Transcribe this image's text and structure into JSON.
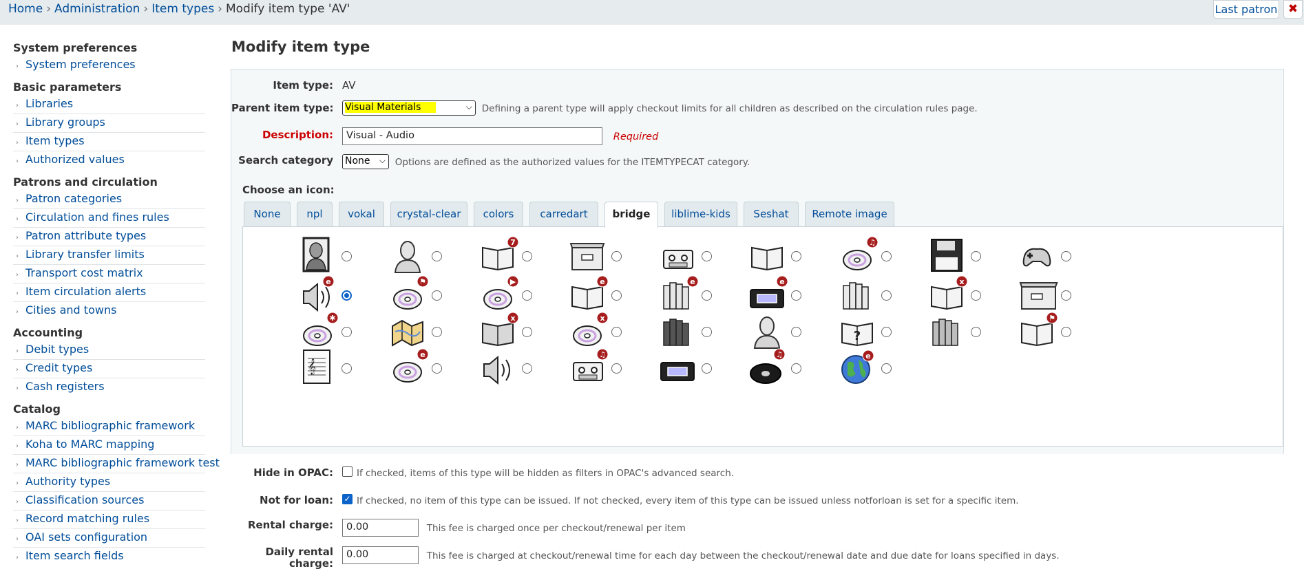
{
  "breadcrumb": {
    "home": "Home",
    "administration": "Administration",
    "item_types": "Item types",
    "current": "Modify item type 'AV'",
    "separator": "›"
  },
  "header": {
    "last_patron": "Last patron",
    "close_glyph": "✖"
  },
  "sidebar": {
    "sections": [
      {
        "title": "System preferences",
        "items": [
          "System preferences"
        ]
      },
      {
        "title": "Basic parameters",
        "items": [
          "Libraries",
          "Library groups",
          "Item types",
          "Authorized values"
        ]
      },
      {
        "title": "Patrons and circulation",
        "items": [
          "Patron categories",
          "Circulation and fines rules",
          "Patron attribute types",
          "Library transfer limits",
          "Transport cost matrix",
          "Item circulation alerts",
          "Cities and towns"
        ]
      },
      {
        "title": "Accounting",
        "items": [
          "Debit types",
          "Credit types",
          "Cash registers"
        ]
      },
      {
        "title": "Catalog",
        "items": [
          "MARC bibliographic framework",
          "Koha to MARC mapping",
          "MARC bibliographic framework test",
          "Authority types",
          "Classification sources",
          "Record matching rules",
          "OAI sets configuration",
          "Item search fields"
        ]
      }
    ]
  },
  "page": {
    "title": "Modify item type"
  },
  "form": {
    "item_type": {
      "label": "Item type:",
      "value": "AV"
    },
    "parent_type": {
      "label": "Parent item type:",
      "value": "Visual Materials",
      "hint": "Defining a parent type will apply checkout limits for all children as described on the circulation rules page."
    },
    "description": {
      "label": "Description:",
      "value": "Visual - Audio",
      "required": "Required"
    },
    "search_category": {
      "label": "Search category",
      "value": "None",
      "hint": "Options are defined as the authorized values for the ITEMTYPECAT category."
    },
    "choose_icon": "Choose an icon:",
    "tabs": [
      "None",
      "npl",
      "vokal",
      "crystal-clear",
      "colors",
      "carredart",
      "bridge",
      "liblime-kids",
      "Seshat",
      "Remote image"
    ],
    "active_tab": "bridge",
    "hide_opac": {
      "label": "Hide in OPAC:",
      "checked": false,
      "hint": "If checked, items of this type will be hidden as filters in OPAC's advanced search."
    },
    "not_for_loan": {
      "label": "Not for loan:",
      "checked": true,
      "hint": "If checked, no item of this type can be issued. If not checked, every item of this type can be issued unless notforloan is set for a specific item."
    },
    "rental_charge": {
      "label": "Rental charge:",
      "value": "0.00",
      "hint": "This fee is charged once per checkout/renewal per item"
    },
    "daily_rental": {
      "label_line1": "Daily rental",
      "label_line2": "charge:",
      "value": "0.00",
      "hint": "This fee is charged at checkout/renewal time for each day between the checkout/renewal date and due date for loans specified in days."
    }
  },
  "icons": [
    [
      "portrait-icon",
      "bust-icon",
      "book-7-icon",
      "box-icon",
      "cassette-icon",
      "open-book-icon",
      "cd-music-icon",
      "floppy-disk-icon",
      "gamepad-icon"
    ],
    [
      "speaker-e-icon",
      "cd-flag-icon",
      "cd-play-icon",
      "book-e-icon",
      "books-e-icon",
      "vhs-e-icon",
      "books-shelf-icon",
      "book-x-icon",
      "archive-box-icon"
    ],
    [
      "cd-star-icon",
      "map-icon",
      "book-x-dark-icon",
      "cd-x-icon",
      "film-reels-icon",
      "bust-statue-icon",
      "book-question-icon",
      "books-gray-icon",
      "book-flag-icon"
    ],
    [
      "sheet-music-icon",
      "cd-e-icon",
      "speaker-icon",
      "cassette-music-icon",
      "vhs-tape-icon",
      "vinyl-record-icon",
      "globe-e-icon"
    ]
  ],
  "selected_icon": "speaker-e-icon",
  "colors": {
    "link": "#004d99",
    "badge": "#a61d1d",
    "highlight": "#ffff00",
    "required": "#cc0000"
  }
}
